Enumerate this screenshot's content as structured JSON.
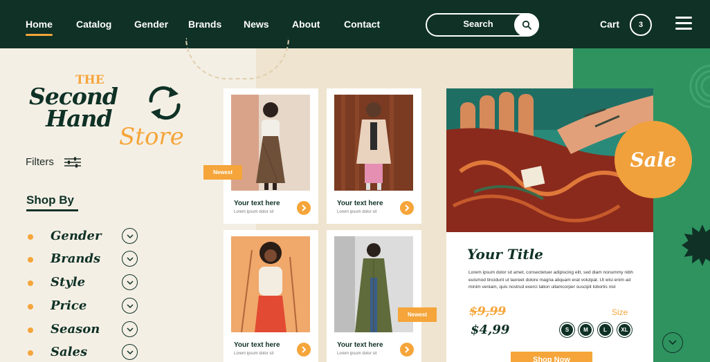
{
  "nav": {
    "links": [
      "Home",
      "Catalog",
      "Gender",
      "Brands",
      "News",
      "About",
      "Contact"
    ],
    "search_placeholder": "Search",
    "cart_label": "Cart",
    "cart_count": "3"
  },
  "logo": {
    "line0": "THE",
    "line1": "Second",
    "line2": "Hand",
    "line3": "Store"
  },
  "sidebar": {
    "filters_label": "Filters",
    "shop_by_title": "Shop By",
    "categories": [
      "Gender",
      "Brands",
      "Style",
      "Price",
      "Season",
      "Sales"
    ]
  },
  "products": [
    {
      "title": "Your text here",
      "subtitle": "Lorem ipsum dolor sit",
      "tag": "Newest"
    },
    {
      "title": "Your text here",
      "subtitle": "Lorem ipsum dolor sit"
    },
    {
      "title": "Your text here",
      "subtitle": "Lorem ipsum dolor sit"
    },
    {
      "title": "Your text here",
      "subtitle": "Lorem ipsum dolor sit",
      "tag": "Newest"
    }
  ],
  "feature": {
    "sale_label": "Sale",
    "title": "Your Title",
    "description": "Lorem ipsum dolor sit amet, consectetuer adipiscing elit, sed diam nonummy nibh euismod tincidunt ut laoreet dolore magna aliquam erat volutpat. Ut wisi enim ad minim veniam, quis nostrud exerci tation ullamcorper suscipit lobortis nisl",
    "old_price": "$9,99",
    "new_price": "$4,99",
    "size_label": "Size",
    "sizes": [
      "S",
      "M",
      "L",
      "XL"
    ],
    "shop_now_label": "Shop Now"
  },
  "colors": {
    "dark_green": "#0f3126",
    "accent_orange": "#f5a53a",
    "green": "#2f9360",
    "cream": "#f3ece0"
  }
}
